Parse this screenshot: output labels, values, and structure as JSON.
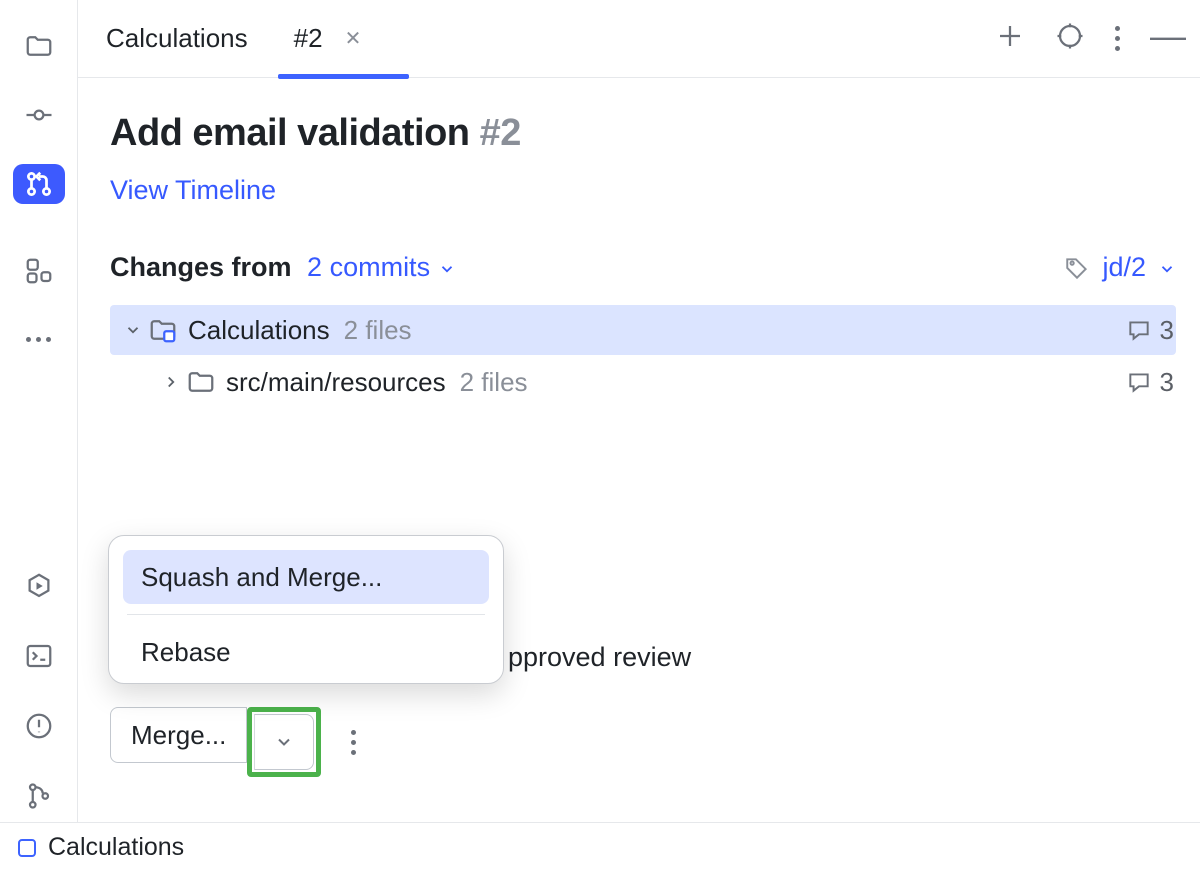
{
  "tabs": {
    "project": "Calculations",
    "pr": "#2"
  },
  "title": {
    "text": "Add email validation",
    "num": "#2"
  },
  "links": {
    "view_timeline": "View Timeline"
  },
  "changes": {
    "label": "Changes from",
    "commits": "2 commits",
    "branch": "jd/2"
  },
  "tree": [
    {
      "name": "Calculations",
      "files": "2 files",
      "comments": "3",
      "expanded": true,
      "repo": true
    },
    {
      "name": "src/main/resources",
      "files": "2 files",
      "comments": "3",
      "expanded": false,
      "repo": false
    }
  ],
  "review_hint": "pproved review",
  "merge": {
    "button": "Merge..."
  },
  "popup": {
    "item1": "Squash and Merge...",
    "item2": "Rebase"
  },
  "status": {
    "project": "Calculations"
  }
}
